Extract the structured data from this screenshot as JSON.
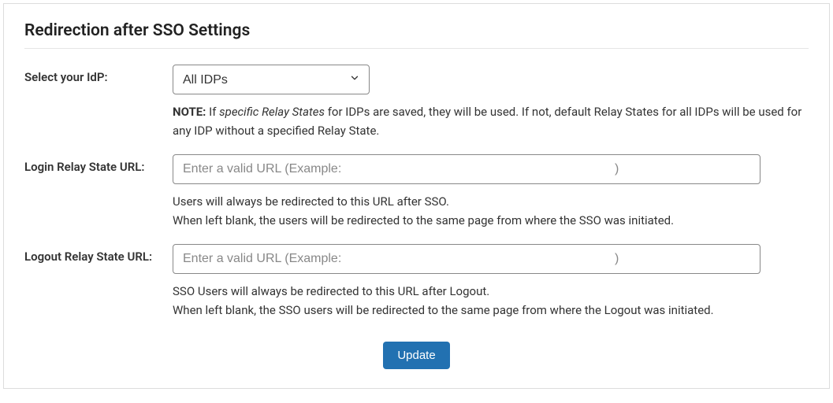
{
  "panel": {
    "title": "Redirection after SSO Settings"
  },
  "fields": {
    "idp": {
      "label": "Select your IdP:",
      "selected": "All IDPs",
      "note_label": "NOTE:",
      "note_prefix": " If ",
      "note_italic": "specific Relay States",
      "note_suffix": " for IDPs are saved, they will be used. If not, default Relay States for all IDPs will be used for any IDP without a specified Relay State."
    },
    "login": {
      "label": "Login Relay State URL:",
      "placeholder": "Enter a valid URL (Example:                                                                              )",
      "help1": "Users will always be redirected to this URL after SSO.",
      "help2": "When left blank, the users will be redirected to the same page from where the SSO was initiated."
    },
    "logout": {
      "label": "Logout Relay State URL:",
      "placeholder": "Enter a valid URL (Example:                                                                              )",
      "help1": "SSO Users will always be redirected to this URL after Logout.",
      "help2": "When left blank, the SSO users will be redirected to the same page from where the Logout was initiated."
    }
  },
  "actions": {
    "update": "Update"
  }
}
